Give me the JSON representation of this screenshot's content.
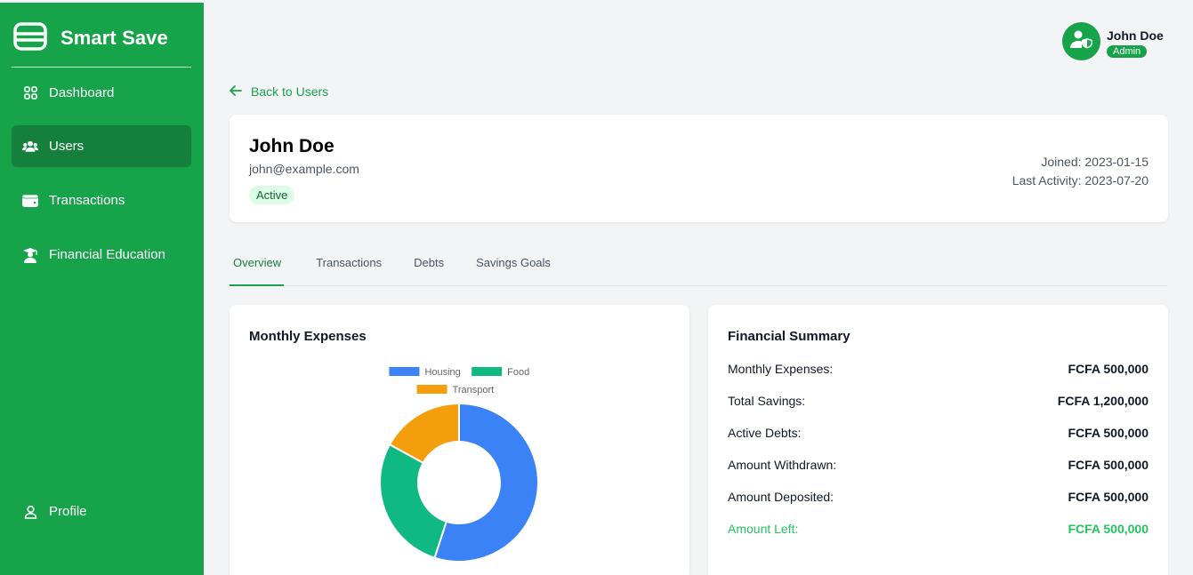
{
  "app": {
    "title": "Smart Save"
  },
  "sidebar": {
    "items": [
      {
        "label": "Dashboard",
        "icon": "dashboard-grid-icon"
      },
      {
        "label": "Users",
        "icon": "users-icon"
      },
      {
        "label": "Transactions",
        "icon": "wallet-icon"
      },
      {
        "label": "Financial Education",
        "icon": "graduation-icon"
      }
    ],
    "profile_label": "Profile"
  },
  "header": {
    "user_name": "John Doe",
    "role": "Admin"
  },
  "back_link": "Back to Users",
  "profile": {
    "name": "John Doe",
    "email": "john@example.com",
    "status": "Active",
    "joined": "Joined: 2023-01-15",
    "last_activity": "Last Activity: 2023-07-20"
  },
  "tabs": [
    {
      "label": "Overview"
    },
    {
      "label": "Transactions"
    },
    {
      "label": "Debts"
    },
    {
      "label": "Savings Goals"
    }
  ],
  "expenses": {
    "title": "Monthly Expenses"
  },
  "chart_data": {
    "type": "pie",
    "categories": [
      "Housing",
      "Food",
      "Transport"
    ],
    "values": [
      55,
      28,
      17
    ],
    "colors": [
      "#3b82f6",
      "#10b981",
      "#f59e0b"
    ],
    "legend": "top"
  },
  "summary": {
    "title": "Financial Summary",
    "rows": [
      {
        "label": "Monthly Expenses:",
        "value": "FCFA 500,000"
      },
      {
        "label": "Total Savings:",
        "value": "FCFA 1,200,000"
      },
      {
        "label": "Active Debts:",
        "value": "FCFA 500,000"
      },
      {
        "label": "Amount Withdrawn:",
        "value": "FCFA 500,000"
      },
      {
        "label": "Amount Deposited:",
        "value": "FCFA 500,000"
      },
      {
        "label": "Amount Left:",
        "value": "FCFA 500,000"
      }
    ]
  },
  "colors": {
    "primary": "#16a34a",
    "primary_dark": "#15803d",
    "highlight": "#22c55e"
  }
}
